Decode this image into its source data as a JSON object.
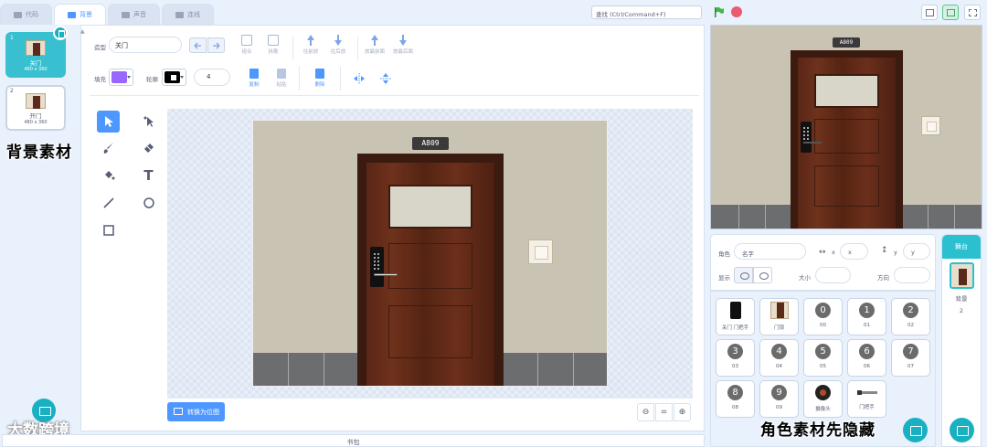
{
  "tabs": [
    {
      "label": "代码",
      "icon": "code-icon"
    },
    {
      "label": "背景",
      "icon": "brush-icon"
    },
    {
      "label": "声音",
      "icon": "sound-icon"
    },
    {
      "label": "连线",
      "icon": "connect-icon"
    }
  ],
  "header": {
    "search_value": "查找 (Ctrl/Command+F)",
    "flag_icon": "green-flag-icon",
    "stop_icon": "stop-icon"
  },
  "costumes": [
    {
      "num": "1",
      "name": "关门",
      "size": "480 x 360"
    },
    {
      "num": "2",
      "name": "开门",
      "size": "480 x 360"
    }
  ],
  "overlay": {
    "left": "背景素材",
    "right": "角色素材先隐藏",
    "watermark": "大数跨境"
  },
  "editor": {
    "backdrop_label": "造型",
    "name_value": "关门",
    "fill_label": "填充",
    "outline_label": "轮廓",
    "outline_width": "4",
    "fill_color": "#9966ff",
    "outline_color": "#000000",
    "top_tools": [
      "组合",
      "拆散",
      "往前放",
      "往后放",
      "放最前面",
      "放最后面"
    ],
    "copy": "复制",
    "paste": "粘贴",
    "delete": "删除",
    "convert": "转换为位图",
    "zoom_reset": "=",
    "backpack": "书包"
  },
  "scene": {
    "room_number": "A809"
  },
  "sprite_info": {
    "sprite_label": "角色",
    "name_placeholder": "名字",
    "x_label": "x",
    "x_value": "x",
    "y_label": "y",
    "y_value": "y",
    "show_label": "显示",
    "size_label": "大小",
    "direction_label": "方向"
  },
  "sprites": [
    {
      "name": "关门 门把手",
      "kind": "lock"
    },
    {
      "name": "门锁",
      "kind": "door"
    },
    {
      "name": "00",
      "kind": "digit",
      "glyph": "0"
    },
    {
      "name": "01",
      "kind": "digit",
      "glyph": "1"
    },
    {
      "name": "02",
      "kind": "digit",
      "glyph": "2"
    },
    {
      "name": "03",
      "kind": "digit",
      "glyph": "3"
    },
    {
      "name": "04",
      "kind": "digit",
      "glyph": "4"
    },
    {
      "name": "05",
      "kind": "digit",
      "glyph": "5"
    },
    {
      "name": "06",
      "kind": "digit",
      "glyph": "6"
    },
    {
      "name": "07",
      "kind": "digit",
      "glyph": "7"
    },
    {
      "name": "08",
      "kind": "digit",
      "glyph": "8"
    },
    {
      "name": "09",
      "kind": "digit",
      "glyph": "9"
    },
    {
      "name": "摄像头",
      "kind": "camera"
    },
    {
      "name": "门把手",
      "kind": "bar"
    }
  ],
  "backdrop_panel": {
    "title": "舞台",
    "label": "背景",
    "count": "2"
  }
}
